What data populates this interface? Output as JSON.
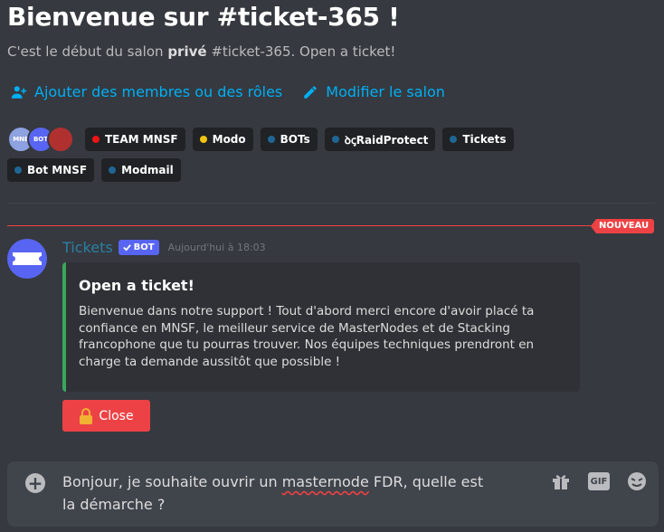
{
  "welcome": {
    "title": "Bienvenue sur #ticket-365 !",
    "subtitle_prefix": "C'est le début du salon ",
    "subtitle_bold": "privé",
    "subtitle_suffix": " #ticket-365. Open a ticket!"
  },
  "actions": {
    "add_members": "Ajouter des membres ou des rôles",
    "edit_channel": "Modifier le salon"
  },
  "avatars": [
    {
      "label": "MNE",
      "color": "#8ea1e1"
    },
    {
      "label": "BOT",
      "color": "#5865f2"
    },
    {
      "label": "",
      "color": "#b03030"
    }
  ],
  "roles": [
    {
      "name": "TEAM MNSF",
      "color": "#ed1515"
    },
    {
      "name": "Modo",
      "color": "#f1c40f"
    },
    {
      "name": "BOTs",
      "color": "#206694"
    },
    {
      "name": "ꝺꞔRaidProtect",
      "color": "#206694"
    },
    {
      "name": "Tickets",
      "color": "#206694"
    },
    {
      "name": "Bot MNSF",
      "color": "#206694"
    },
    {
      "name": "Modmail",
      "color": "#206694"
    }
  ],
  "divider": {
    "new_label": "NOUVEAU"
  },
  "message": {
    "author": "Tickets",
    "bot_tag": "BOT",
    "timestamp": "Aujourd'hui à 18:03",
    "avatar_text": "Tickets",
    "embed": {
      "title": "Open a ticket!",
      "description": "Bienvenue dans notre support ! Tout d'abord merci encore d'avoir placé ta confiance en MNSF, le meilleur service de MasterNodes et de Stacking francophone que tu pourras trouver. Nos équipes techniques prendront en charge ta demande aussitôt que possible !",
      "accent_color": "#3ba55c"
    },
    "button": {
      "label": "Close",
      "icon": "lock-icon",
      "color": "#ed4245"
    }
  },
  "composer": {
    "text_before": "Bonjour, je souhaite ouvrir un ",
    "text_typo": "masternode",
    "text_after": " FDR, quelle est la démarche ?",
    "gif_label": "GIF"
  }
}
